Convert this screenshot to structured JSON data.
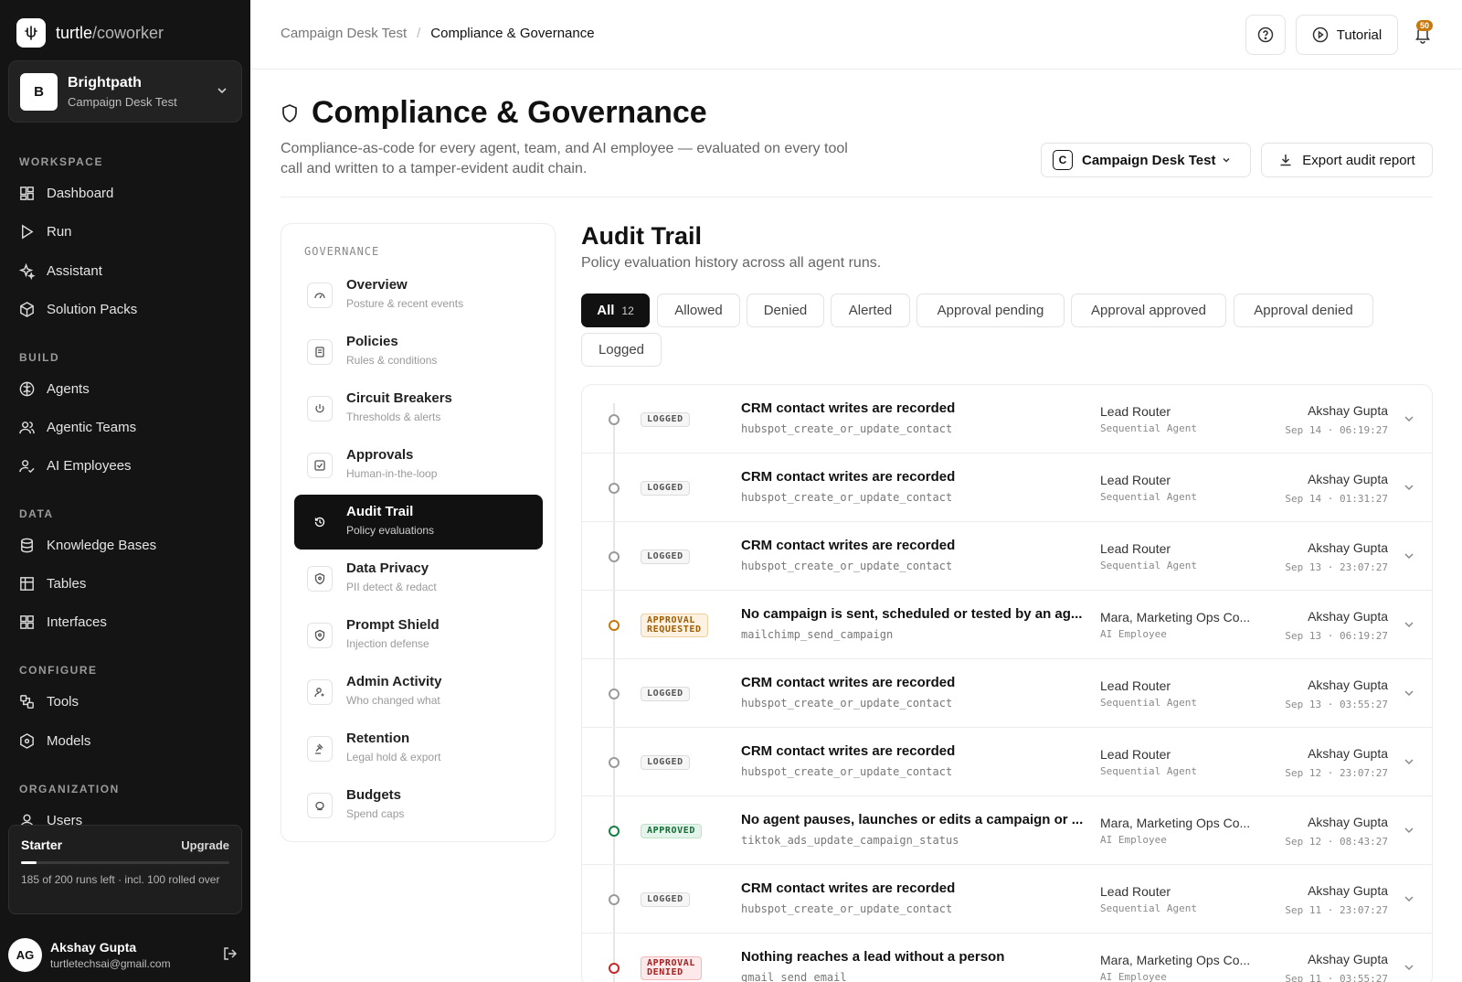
{
  "app": {
    "brand": "turtle",
    "brand_sub": "/coworker"
  },
  "workspace": {
    "initial": "B",
    "name": "Brightpath",
    "project": "Campaign Desk Test"
  },
  "sidebar": {
    "sections": {
      "workspace": "WORKSPACE",
      "build": "BUILD",
      "data": "DATA",
      "configure": "CONFIGURE",
      "organization": "ORGANIZATION"
    },
    "items": {
      "dashboard": "Dashboard",
      "run": "Run",
      "assistant": "Assistant",
      "solution_packs": "Solution Packs",
      "agents": "Agents",
      "agentic_teams": "Agentic Teams",
      "ai_employees": "AI Employees",
      "knowledge_bases": "Knowledge Bases",
      "tables": "Tables",
      "interfaces": "Interfaces",
      "tools": "Tools",
      "models": "Models",
      "users": "Users"
    }
  },
  "plan": {
    "name": "Starter",
    "upgrade": "Upgrade",
    "usage_fraction": 0.075,
    "note": "185 of 200 runs left · incl. 100 rolled over"
  },
  "user": {
    "initials": "AG",
    "name": "Akshay Gupta",
    "email": "turtletechsai@gmail.com"
  },
  "topbar": {
    "breadcrumb_parent": "Campaign Desk Test",
    "breadcrumb_sep": "/",
    "breadcrumb_current": "Compliance & Governance",
    "tutorial": "Tutorial",
    "notifications": "50"
  },
  "header": {
    "title": "Compliance & Governance",
    "description": "Compliance-as-code for every agent, team, and AI employee — evaluated on every tool call and written to a tamper-evident audit chain.",
    "project_chip": "C",
    "project_select": "Campaign Desk Test",
    "export": "Export audit report"
  },
  "governance": {
    "label": "GOVERNANCE",
    "items": [
      {
        "title": "Overview",
        "sub": "Posture & recent events"
      },
      {
        "title": "Policies",
        "sub": "Rules & conditions"
      },
      {
        "title": "Circuit Breakers",
        "sub": "Thresholds & alerts"
      },
      {
        "title": "Approvals",
        "sub": "Human-in-the-loop"
      },
      {
        "title": "Audit Trail",
        "sub": "Policy evaluations"
      },
      {
        "title": "Data Privacy",
        "sub": "PII detect & redact"
      },
      {
        "title": "Prompt Shield",
        "sub": "Injection defense"
      },
      {
        "title": "Admin Activity",
        "sub": "Who changed what"
      },
      {
        "title": "Retention",
        "sub": "Legal hold & export"
      },
      {
        "title": "Budgets",
        "sub": "Spend caps"
      }
    ]
  },
  "audit": {
    "title": "Audit Trail",
    "subtitle": "Policy evaluation history across all agent runs.",
    "filters": [
      {
        "label": "All",
        "count": "12"
      },
      {
        "label": "Allowed"
      },
      {
        "label": "Denied"
      },
      {
        "label": "Alerted"
      },
      {
        "label": "Approval pending"
      },
      {
        "label": "Approval approved"
      },
      {
        "label": "Approval denied"
      },
      {
        "label": "Logged"
      }
    ],
    "rows": [
      {
        "status": "LOGGED",
        "title": "CRM contact writes are recorded",
        "tool": "hubspot_create_or_update_contact",
        "agent": "Lead Router",
        "agent_type": "Sequential Agent",
        "user": "Akshay Gupta",
        "time": "Sep 14 · 06:19:27"
      },
      {
        "status": "LOGGED",
        "title": "CRM contact writes are recorded",
        "tool": "hubspot_create_or_update_contact",
        "agent": "Lead Router",
        "agent_type": "Sequential Agent",
        "user": "Akshay Gupta",
        "time": "Sep 14 · 01:31:27"
      },
      {
        "status": "LOGGED",
        "title": "CRM contact writes are recorded",
        "tool": "hubspot_create_or_update_contact",
        "agent": "Lead Router",
        "agent_type": "Sequential Agent",
        "user": "Akshay Gupta",
        "time": "Sep 13 · 23:07:27"
      },
      {
        "status": "APPROVAL REQUESTED",
        "status_l1": "APPROVAL",
        "status_l2": "REQUESTED",
        "title": "No campaign is sent, scheduled or tested by an ag...",
        "tool": "mailchimp_send_campaign",
        "agent": "Mara, Marketing Ops Co...",
        "agent_type": "AI Employee",
        "user": "Akshay Gupta",
        "time": "Sep 13 · 06:19:27"
      },
      {
        "status": "LOGGED",
        "title": "CRM contact writes are recorded",
        "tool": "hubspot_create_or_update_contact",
        "agent": "Lead Router",
        "agent_type": "Sequential Agent",
        "user": "Akshay Gupta",
        "time": "Sep 13 · 03:55:27"
      },
      {
        "status": "LOGGED",
        "title": "CRM contact writes are recorded",
        "tool": "hubspot_create_or_update_contact",
        "agent": "Lead Router",
        "agent_type": "Sequential Agent",
        "user": "Akshay Gupta",
        "time": "Sep 12 · 23:07:27"
      },
      {
        "status": "APPROVED",
        "title": "No agent pauses, launches or edits a campaign or ...",
        "tool": "tiktok_ads_update_campaign_status",
        "agent": "Mara, Marketing Ops Co...",
        "agent_type": "AI Employee",
        "user": "Akshay Gupta",
        "time": "Sep 12 · 08:43:27"
      },
      {
        "status": "LOGGED",
        "title": "CRM contact writes are recorded",
        "tool": "hubspot_create_or_update_contact",
        "agent": "Lead Router",
        "agent_type": "Sequential Agent",
        "user": "Akshay Gupta",
        "time": "Sep 11 · 23:07:27"
      },
      {
        "status": "APPROVAL DENIED",
        "status_l1": "APPROVAL",
        "status_l2": "DENIED",
        "title": "Nothing reaches a lead without a person",
        "tool": "gmail_send_email",
        "agent": "Mara, Marketing Ops Co...",
        "agent_type": "AI Employee",
        "user": "Akshay Gupta",
        "time": "Sep 11 · 03:55:27"
      }
    ]
  },
  "colors": {
    "sidebar_bg": "#141414",
    "approval": "#c8780a",
    "approved": "#13803f",
    "denied": "#c62828"
  }
}
